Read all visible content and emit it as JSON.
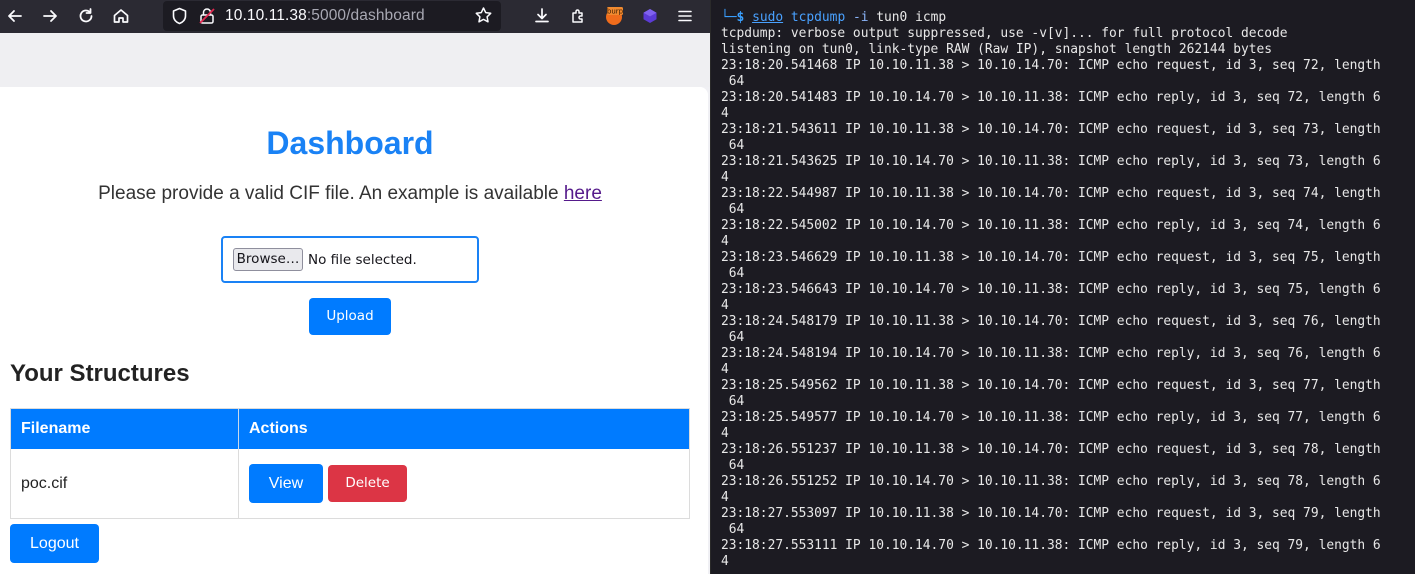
{
  "browser": {
    "url_host": "10.10.11.38",
    "url_path": ":5000/dashboard",
    "extension_badge": "burp"
  },
  "page": {
    "title": "Dashboard",
    "subtitle": "Please provide a valid CIF file. An example is available",
    "subtitle_link": "here",
    "browse_label": "Browse…",
    "file_status": "No file selected.",
    "upload_label": "Upload",
    "structures_heading": "Your Structures",
    "table": {
      "headers": [
        "Filename",
        "Actions"
      ],
      "rows": [
        {
          "filename": "poc.cif",
          "view_label": "View",
          "delete_label": "Delete"
        }
      ]
    },
    "logout_label": "Logout"
  },
  "terminal": {
    "command": {
      "prompt": "└─$",
      "sudo": "sudo",
      "program": "tcpdump",
      "option": "-i",
      "args": "tun0 icmp"
    },
    "lines": [
      "tcpdump: verbose output suppressed, use -v[v]... for full protocol decode",
      "listening on tun0, link-type RAW (Raw IP), snapshot length 262144 bytes",
      "23:18:20.541468 IP 10.10.11.38 > 10.10.14.70: ICMP echo request, id 3, seq 72, length",
      " 64",
      "23:18:20.541483 IP 10.10.14.70 > 10.10.11.38: ICMP echo reply, id 3, seq 72, length 6",
      "4",
      "23:18:21.543611 IP 10.10.11.38 > 10.10.14.70: ICMP echo request, id 3, seq 73, length",
      " 64",
      "23:18:21.543625 IP 10.10.14.70 > 10.10.11.38: ICMP echo reply, id 3, seq 73, length 6",
      "4",
      "23:18:22.544987 IP 10.10.11.38 > 10.10.14.70: ICMP echo request, id 3, seq 74, length",
      " 64",
      "23:18:22.545002 IP 10.10.14.70 > 10.10.11.38: ICMP echo reply, id 3, seq 74, length 6",
      "4",
      "23:18:23.546629 IP 10.10.11.38 > 10.10.14.70: ICMP echo request, id 3, seq 75, length",
      " 64",
      "23:18:23.546643 IP 10.10.14.70 > 10.10.11.38: ICMP echo reply, id 3, seq 75, length 6",
      "4",
      "23:18:24.548179 IP 10.10.11.38 > 10.10.14.70: ICMP echo request, id 3, seq 76, length",
      " 64",
      "23:18:24.548194 IP 10.10.14.70 > 10.10.11.38: ICMP echo reply, id 3, seq 76, length 6",
      "4",
      "23:18:25.549562 IP 10.10.11.38 > 10.10.14.70: ICMP echo request, id 3, seq 77, length",
      " 64",
      "23:18:25.549577 IP 10.10.14.70 > 10.10.11.38: ICMP echo reply, id 3, seq 77, length 6",
      "4",
      "23:18:26.551237 IP 10.10.11.38 > 10.10.14.70: ICMP echo request, id 3, seq 78, length",
      " 64",
      "23:18:26.551252 IP 10.10.14.70 > 10.10.11.38: ICMP echo reply, id 3, seq 78, length 6",
      "4",
      "23:18:27.553097 IP 10.10.11.38 > 10.10.14.70: ICMP echo request, id 3, seq 79, length",
      " 64",
      "23:18:27.553111 IP 10.10.14.70 > 10.10.11.38: ICMP echo reply, id 3, seq 79, length 6",
      "4"
    ]
  },
  "colors": {
    "accent": "#007bff",
    "title": "#1a82f5",
    "danger": "#dc3545",
    "terminal_bg": "#1c1b22",
    "toolbar_bg": "#2b2a33"
  }
}
